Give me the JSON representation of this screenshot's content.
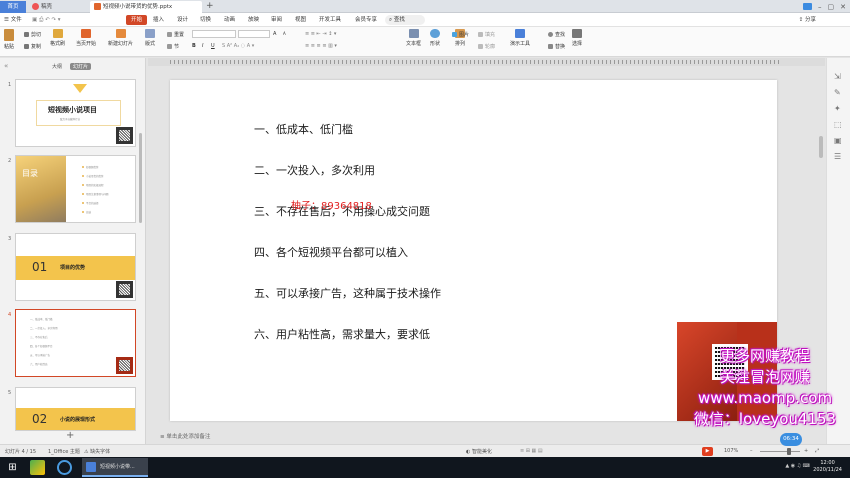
{
  "tabs": {
    "home": "首页",
    "draw": "稿壳",
    "file": "短视频小说带货的优势.pptx",
    "new_tab": "+"
  },
  "menu": {
    "file": "文件",
    "items": [
      "开始",
      "插入",
      "设计",
      "切换",
      "动画",
      "放映",
      "审阅",
      "视图",
      "开发工具",
      "会员专享"
    ],
    "search": "查找",
    "share": "分享"
  },
  "ribbon": {
    "paste": "粘贴",
    "cut": "剪切",
    "copy": "复制",
    "format_painter": "格式刷",
    "from_current": "当页开始",
    "new_slide": "新建幻灯片",
    "layout": "版式",
    "section": "节",
    "reset": "重置",
    "textbox": "文本框",
    "shape": "形状",
    "arrange": "排列",
    "picture": "图片",
    "fill": "填充",
    "outline": "轮廓",
    "presentation_tools": "演示工具",
    "replace": "替换",
    "select": "选择",
    "find": "查找",
    "bold": "B",
    "italic": "I",
    "underline": "U",
    "font_grow": "A",
    "font_shrink": "A"
  },
  "left_panel": {
    "tab_outline": "大纲",
    "tab_slides": "幻灯片",
    "add": "+",
    "thumbs": [
      {
        "num": "1",
        "title": "短视频小说项目",
        "sub": "致力于自媒体行业"
      },
      {
        "num": "2",
        "title": "目录",
        "items": [
          "短视频优势",
          "小说带货的优势",
          "项目的实操流程",
          "项目注意事项与问题",
          "平台的选择",
          "总结"
        ]
      },
      {
        "num": "3",
        "big": "01",
        "title": "项目的优势"
      },
      {
        "num": "4",
        "lines": [
          "一、低成本、低门槛",
          "二、一次投入，多次利用",
          "三、不存在售后",
          "四、各个短视频平台",
          "五、可以承接广告",
          "六、用户粘性高"
        ]
      },
      {
        "num": "5",
        "big": "02",
        "title": "小说的展现形式"
      }
    ]
  },
  "slide": {
    "lines": [
      "一、低成本、低门槛",
      "二、一次投入，多次利用",
      "三、不存在售后，不用操心成交问题",
      "四、各个短视频平台都可以植入",
      "五、可以承接广告，这种属于技术操作",
      "六、用户粘性高，需求量大，要求低"
    ],
    "overlay_red": "柚子：89364818"
  },
  "notes_placeholder": "单击此处添加备注",
  "status": {
    "slide_counter": "幻灯片 4 / 15",
    "theme": "1_Office 主题",
    "missing_font": "缺失字体",
    "smart_beautify": "智能美化",
    "zoom": "107%"
  },
  "watermark": {
    "line1": "更多网赚教程",
    "line2": "关注冒泡网赚",
    "line3": "www.maomp.com",
    "line4": "微信：loveyou4153"
  },
  "badge": "06:34",
  "taskbar": {
    "app_title": "短视频小说带...",
    "time": "12:00",
    "date": "2020/11/24"
  },
  "colors": {
    "accent": "#d24726",
    "thumb_yellow": "#f3c44c",
    "watermark_glow": "#d01ad0"
  }
}
